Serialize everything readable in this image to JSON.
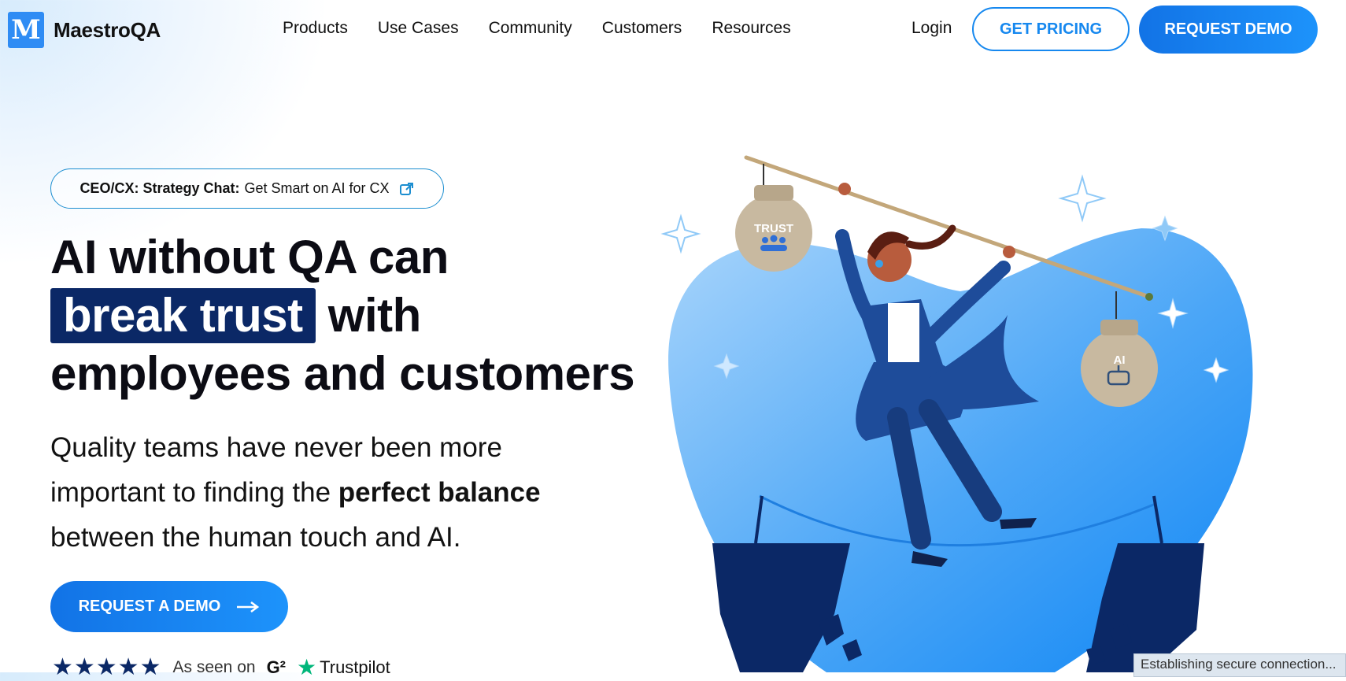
{
  "nav": {
    "logo_mark": "M",
    "logo_text": "MaestroQA",
    "items": [
      {
        "label": "Products"
      },
      {
        "label": "Use Cases"
      },
      {
        "label": "Community"
      },
      {
        "label": "Customers"
      },
      {
        "label": "Resources"
      }
    ],
    "login": "Login",
    "get_pricing": "GET PRICING",
    "request_demo": "REQUEST DEMO"
  },
  "banner": {
    "bold_prefix": "CEO/CX: Strategy Chat:",
    "text": "Get Smart on AI for CX",
    "icon": "external-link-icon"
  },
  "hero": {
    "line1": "AI without QA can",
    "highlight": "break trust",
    "line2_rest": "with",
    "line3": "employees and customers",
    "sub_part1": "Quality teams have never been more important to finding the",
    "sub_bold": "perfect balance",
    "sub_part2": "between the human touch and AI.",
    "cta_label": "REQUEST A DEMO",
    "cta_icon": "arrow-right-icon"
  },
  "social_proof": {
    "stars": "★★★★★",
    "seen_on": "As seen on",
    "g2": "G²",
    "trustpilot": "Trustpilot"
  },
  "illustration": {
    "bag_left": "TRUST",
    "bag_right": "AI"
  },
  "status_bar": "Establishing secure connection...",
  "colors": {
    "accent": "#1688ef",
    "navy": "#0b2866",
    "trustpilot_green": "#00b67a"
  }
}
